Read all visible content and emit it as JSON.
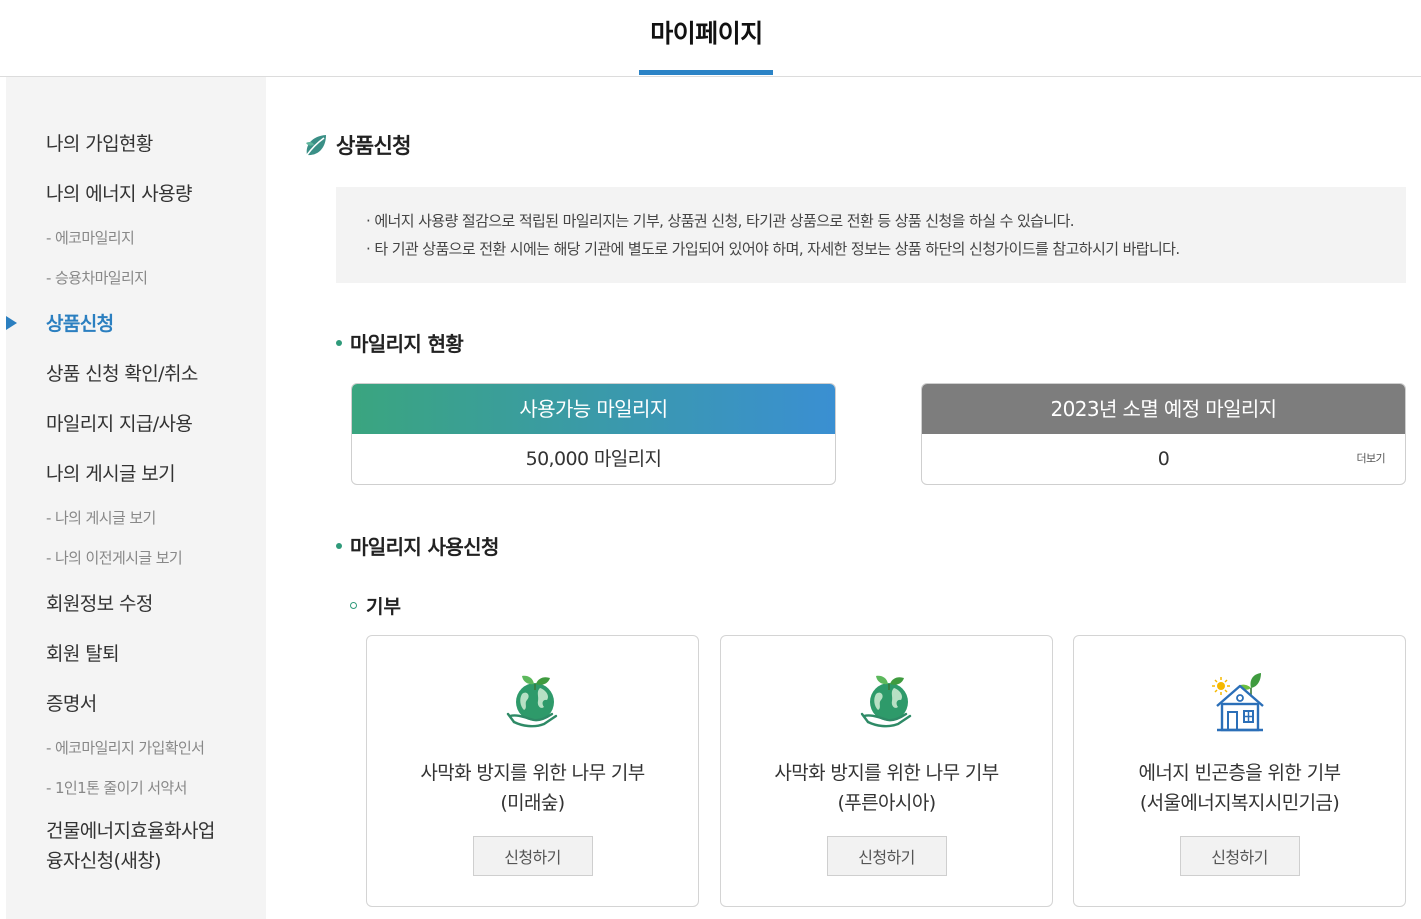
{
  "header": {
    "title": "마이페이지"
  },
  "sidebar": {
    "items": [
      {
        "label": "나의 가입현황"
      },
      {
        "label": "나의 에너지 사용량"
      },
      {
        "label": "- 에코마일리지"
      },
      {
        "label": "- 승용차마일리지"
      },
      {
        "label": "상품신청"
      },
      {
        "label": "상품 신청 확인/취소"
      },
      {
        "label": "마일리지 지급/사용"
      },
      {
        "label": "나의 게시글 보기"
      },
      {
        "label": "- 나의 게시글 보기"
      },
      {
        "label": "- 나의 이전게시글 보기"
      },
      {
        "label": "회원정보 수정"
      },
      {
        "label": "회원 탈퇴"
      },
      {
        "label": "증명서"
      },
      {
        "label": "- 에코마일리지 가입확인서"
      },
      {
        "label": "- 1인1톤 줄이기 서약서"
      },
      {
        "label_line1": "건물에너지효율화사업",
        "label_line2": "융자신청(새창)"
      }
    ]
  },
  "main": {
    "heading": "상품신청",
    "notice": [
      "· 에너지 사용량 절감으로 적립된 마일리지는 기부, 상품권 신청, 타기관 상품으로 전환 등 상품 신청을 하실 수 있습니다.",
      "· 타 기관 상품으로 전환 시에는 해당 기관에 별도로 가입되어 있어야 하며, 자세한 정보는 상품 하단의 신청가이드를 참고하시기 바랍니다."
    ],
    "mileage_status": {
      "title": "마일리지 현황",
      "available": {
        "label": "사용가능 마일리지",
        "value": "50,000 마일리지"
      },
      "expiring": {
        "label": "2023년 소멸 예정 마일리지",
        "value": "0",
        "more": "더보기"
      }
    },
    "usage": {
      "title": "마일리지 사용신청",
      "donation_title": "기부",
      "cards": [
        {
          "line1": "사막화 방지를 위한 나무 기부",
          "line2": "(미래숲)",
          "button": "신청하기",
          "icon": "globe-plant-hand-icon"
        },
        {
          "line1": "사막화 방지를 위한 나무 기부",
          "line2": "(푸른아시아)",
          "button": "신청하기",
          "icon": "globe-plant-hand-icon"
        },
        {
          "line1": "에너지 빈곤층을 위한 기부",
          "line2": "(서울에너지복지시민기금)",
          "button": "신청하기",
          "icon": "house-sun-plant-icon"
        }
      ]
    }
  },
  "colors": {
    "accent": "#2b83c6",
    "active": "#2b7fc0",
    "green": "#2f9a7a",
    "gray_header": "#7d7d7d"
  }
}
